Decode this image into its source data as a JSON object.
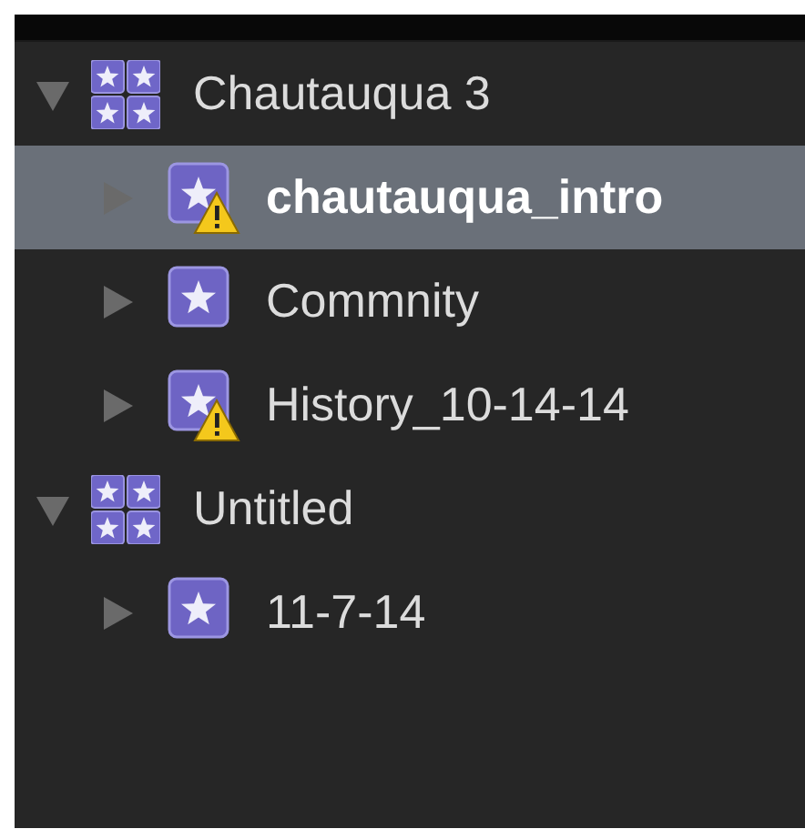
{
  "libraries": [
    {
      "name": "Chautauqua 3",
      "expanded": true,
      "selected": false,
      "children": [
        {
          "name": "chautauqua_intro",
          "expanded": false,
          "selected": true,
          "warning": true
        },
        {
          "name": "Commnity",
          "expanded": false,
          "selected": false,
          "warning": false
        },
        {
          "name": "History_10-14-14",
          "expanded": false,
          "selected": false,
          "warning": true
        }
      ]
    },
    {
      "name": "Untitled",
      "expanded": true,
      "selected": false,
      "children": [
        {
          "name": "11-7-14",
          "expanded": false,
          "selected": false,
          "warning": false
        }
      ]
    }
  ]
}
